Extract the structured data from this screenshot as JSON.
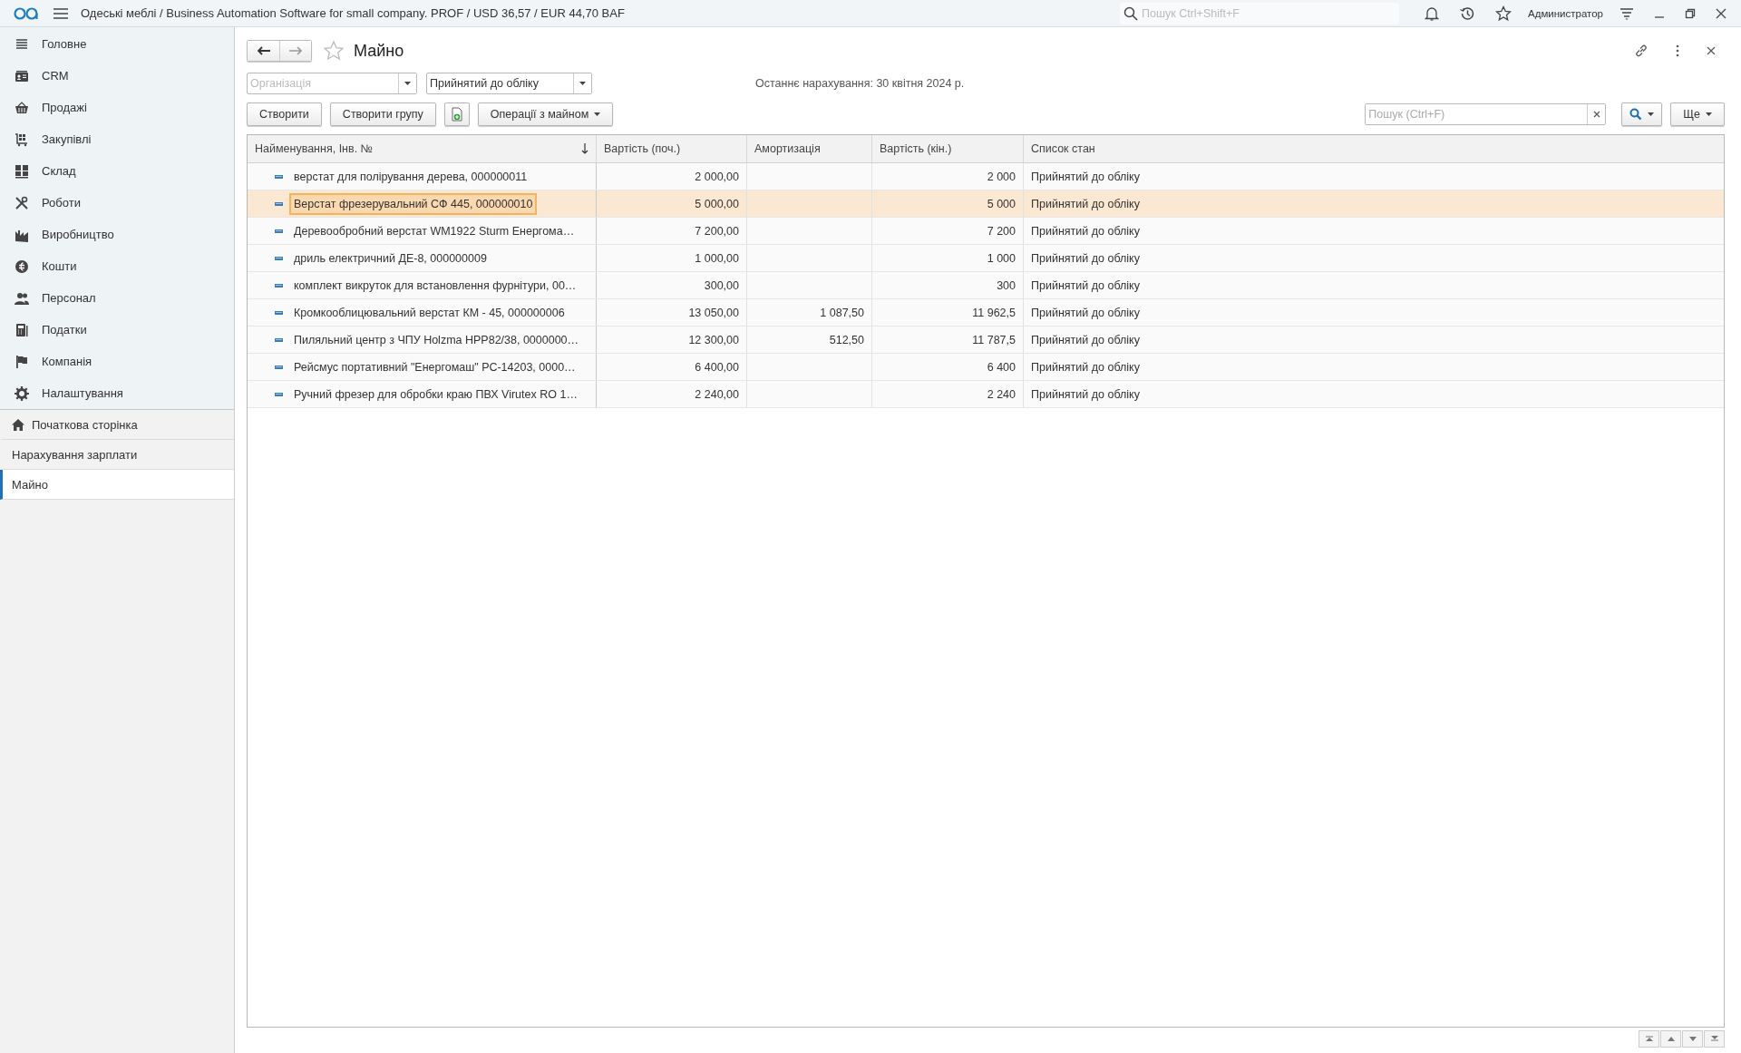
{
  "top_bar": {
    "title": "Одеські меблі / Business Automation Software for small company. PROF / USD 36,57 / EUR 44,70 BAF",
    "search": {
      "placeholder": "Пошук Ctrl+Shift+F"
    },
    "user": "Администратор"
  },
  "sidebar": {
    "items": [
      {
        "label": "Головне"
      },
      {
        "label": "CRM"
      },
      {
        "label": "Продажі"
      },
      {
        "label": "Закупівлі"
      },
      {
        "label": "Склад"
      },
      {
        "label": "Роботи"
      },
      {
        "label": "Виробництво"
      },
      {
        "label": "Кошти"
      },
      {
        "label": "Персонал"
      },
      {
        "label": "Податки"
      },
      {
        "label": "Компанія"
      },
      {
        "label": "Налаштування"
      }
    ],
    "open_pages": [
      {
        "label": "Початкова сторінка",
        "kind": "home",
        "selected": false
      },
      {
        "label": "Нарахування зарплати",
        "kind": "page",
        "selected": false
      },
      {
        "label": "Майно",
        "kind": "page",
        "selected": true
      }
    ]
  },
  "form": {
    "title": "Майно",
    "organization": {
      "placeholder": "Організація"
    },
    "status_filter": {
      "value": "Прийнятий до обліку"
    },
    "last_accrual": "Останнє нарахування: 30 квітня 2024 р.",
    "buttons": [
      {
        "label": "Створити",
        "kind": "text"
      },
      {
        "label": "Створити групу",
        "kind": "text"
      },
      {
        "kind": "icon"
      },
      {
        "label": "Операції з майном",
        "kind": "menu"
      }
    ],
    "search": {
      "placeholder": "Пошук (Ctrl+F)"
    },
    "more_button": "Ще"
  },
  "table": {
    "columns": [
      {
        "label": "Найменування, Інв. №",
        "sorted": true
      },
      {
        "label": "Вартість (поч.)",
        "sorted": false
      },
      {
        "label": "Амортизація",
        "sorted": false
      },
      {
        "label": "Вартість (кін.)",
        "sorted": false
      },
      {
        "label": "Список стан",
        "sorted": false
      }
    ],
    "rows": [
      {
        "cells": [
          "верстат для полірування дерева, 000000011",
          "2 000,00",
          "",
          "2 000",
          "Прийнятий до обліку"
        ],
        "selected": false
      },
      {
        "cells": [
          "Верстат фрезерувальний СФ 445, 000000010",
          "5 000,00",
          "",
          "5 000",
          "Прийнятий до обліку"
        ],
        "selected": true
      },
      {
        "cells": [
          "Деревообробний верстат WM1922 Sturm Енергома…",
          "7 200,00",
          "",
          "7 200",
          "Прийнятий до обліку"
        ],
        "selected": false
      },
      {
        "cells": [
          "дриль електричний ДЕ-8, 000000009",
          "1 000,00",
          "",
          "1 000",
          "Прийнятий до обліку"
        ],
        "selected": false
      },
      {
        "cells": [
          "комплект викруток для встановлення фурнітури, 00…",
          "300,00",
          "",
          "300",
          "Прийнятий до обліку"
        ],
        "selected": false
      },
      {
        "cells": [
          "Кромкооблицювальний верстат КМ - 45, 000000006",
          "13 050,00",
          "1 087,50",
          "11 962,5",
          "Прийнятий до обліку"
        ],
        "selected": false
      },
      {
        "cells": [
          "Пиляльний центр з ЧПУ Holzma HPP82/38, 0000000…",
          "12 300,00",
          "512,50",
          "11 787,5",
          "Прийнятий до обліку"
        ],
        "selected": false
      },
      {
        "cells": [
          "Рейсмус портативний \"Енергомаш\" РС-14203, 0000…",
          "6 400,00",
          "",
          "6 400",
          "Прийнятий до обліку"
        ],
        "selected": false
      },
      {
        "cells": [
          "Ручний фрезер для обробки краю ПВХ Virutex RO 1…",
          "2 240,00",
          "",
          "2 240",
          "Прийнятий до обліку"
        ],
        "selected": false
      }
    ]
  }
}
